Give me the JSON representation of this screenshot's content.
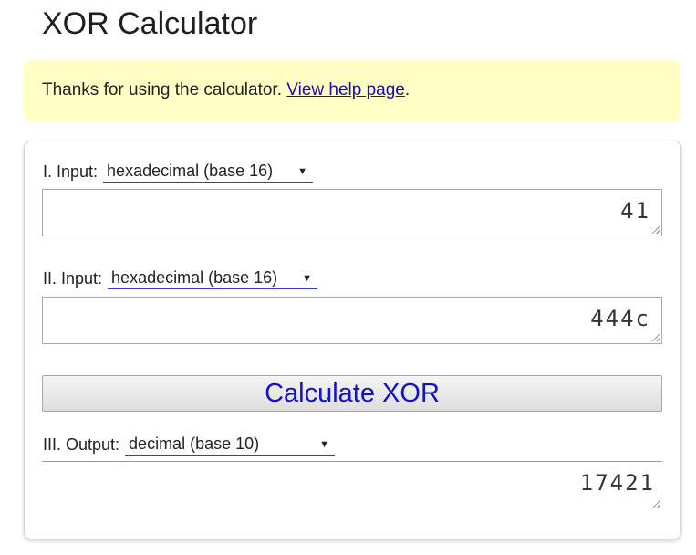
{
  "page": {
    "title": "XOR Calculator"
  },
  "notice": {
    "text": "Thanks for using the calculator. ",
    "link_text": "View help page",
    "suffix": "."
  },
  "input1": {
    "label": "I. Input:",
    "base": "hexadecimal (base 16)",
    "value": "41"
  },
  "input2": {
    "label": "II. Input:",
    "base": "hexadecimal (base 16)",
    "value": "444c"
  },
  "calculate": {
    "label": "Calculate XOR"
  },
  "output": {
    "label": "III. Output:",
    "base": "decimal (base 10)",
    "value": "17421"
  },
  "colors": {
    "notice_bg": "#ffffc5",
    "link": "#1a0dab",
    "button_text": "#1212cc",
    "select_underline": "#2a3bd0"
  }
}
